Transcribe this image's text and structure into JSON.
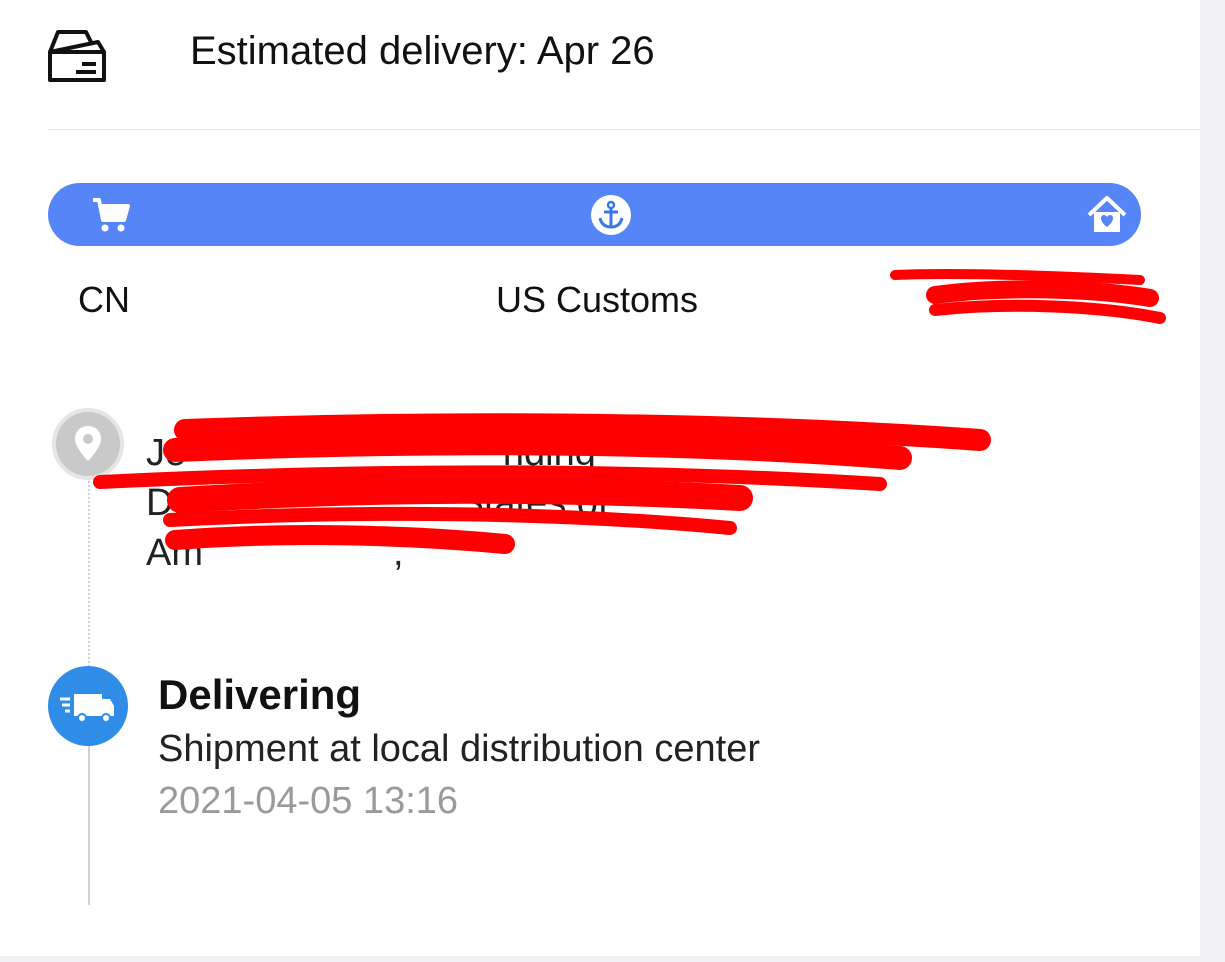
{
  "header": {
    "title": "Estimated delivery: Apr 26",
    "icon": "package-box-icon"
  },
  "progress": {
    "color": "#5585f7",
    "icons": [
      "cart-icon",
      "anchor-icon",
      "home-heart-icon"
    ],
    "stages": {
      "origin": "CN",
      "customs": "US Customs",
      "destination": ""
    }
  },
  "address": {
    "line1": "Je                              nding",
    "line2": "Dr,                         States of",
    "line3": "Am                  ,"
  },
  "events": [
    {
      "status": "Delivering",
      "description": "Shipment at local distribution center",
      "time": "2021-04-05 13:16",
      "icon": "truck-icon",
      "color": "#2f8de8"
    }
  ],
  "redaction_color": "#ff0000"
}
